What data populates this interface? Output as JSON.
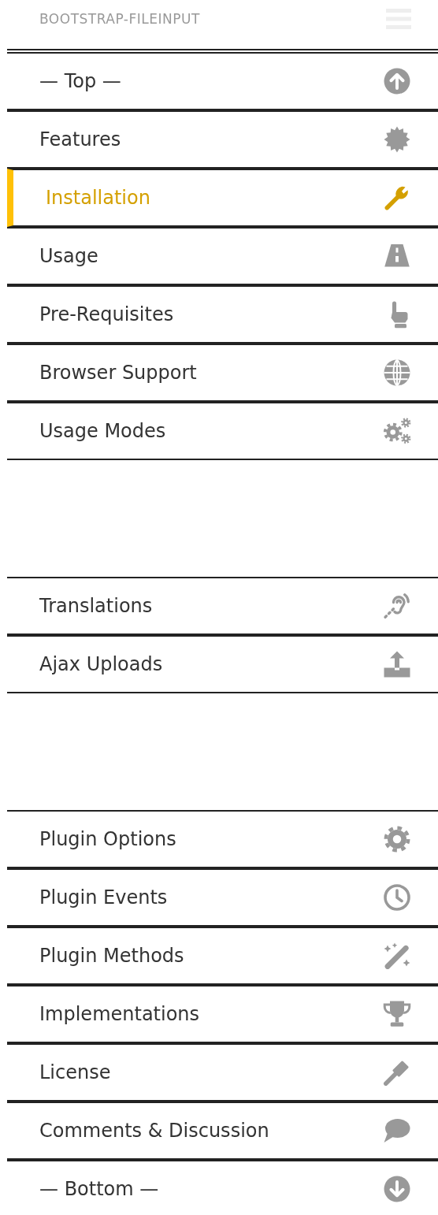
{
  "header": {
    "title": "BOOTSTRAP-FILEINPUT"
  },
  "groups": [
    {
      "items": [
        {
          "label": "— Top —",
          "selected": false
        },
        {
          "label": "Features",
          "selected": false
        },
        {
          "label": "Installation",
          "selected": true
        },
        {
          "label": "Usage",
          "selected": false
        },
        {
          "label": "Pre-Requisites",
          "selected": false
        },
        {
          "label": "Browser Support",
          "selected": false
        },
        {
          "label": "Usage Modes",
          "selected": false
        }
      ]
    },
    {
      "items": [
        {
          "label": "Translations",
          "selected": false
        },
        {
          "label": "Ajax Uploads",
          "selected": false
        }
      ]
    },
    {
      "items": [
        {
          "label": "Plugin Options",
          "selected": false
        },
        {
          "label": "Plugin Events",
          "selected": false
        },
        {
          "label": "Plugin Methods",
          "selected": false
        },
        {
          "label": "Implementations",
          "selected": false
        },
        {
          "label": "License",
          "selected": false
        },
        {
          "label": "Comments & Discussion",
          "selected": false
        },
        {
          "label": "— Bottom —",
          "selected": false
        }
      ]
    }
  ]
}
